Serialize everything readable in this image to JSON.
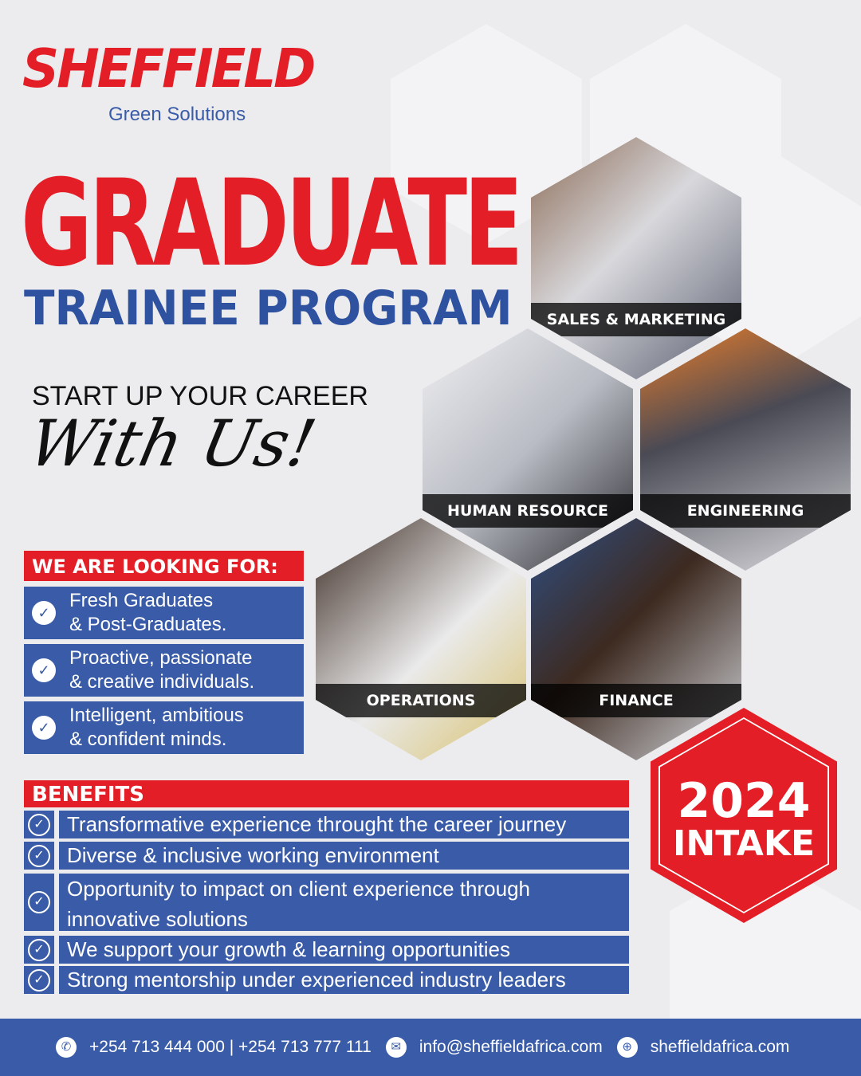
{
  "brand": {
    "name": "SHEFFIELD",
    "tagline": "Green Solutions",
    "red": "#e31e26",
    "blue": "#3a5ca8"
  },
  "headline": {
    "line1": "GRADUATE",
    "line2": "TRAINEE PROGRAM"
  },
  "tagline": {
    "line1": "START UP YOUR CAREER",
    "script": "With Us!"
  },
  "looking_for": {
    "title": "WE ARE LOOKING FOR:",
    "items": [
      {
        "l1": "Fresh Graduates",
        "l2": "& Post-Graduates."
      },
      {
        "l1": "Proactive, passionate",
        "l2": "& creative individuals."
      },
      {
        "l1": "Intelligent, ambitious",
        "l2": "& confident minds."
      }
    ]
  },
  "benefits": {
    "title": "BENEFITS",
    "items": [
      "Transformative experience throught the career journey",
      "Diverse & inclusive working environment",
      "Opportunity to impact on client experience through innovative solutions",
      "We support your growth & learning opportunities",
      "Strong mentorship under experienced industry leaders"
    ]
  },
  "departments": [
    "SALES & MARKETING",
    "HUMAN RESOURCE",
    "ENGINEERING",
    "OPERATIONS",
    "FINANCE"
  ],
  "intake": {
    "year": "2024",
    "label": "INTAKE"
  },
  "footer": {
    "phone": "+254 713 444 000 | +254 713 777 111",
    "email": "info@sheffieldafrica.com",
    "website": "sheffieldafrica.com"
  }
}
